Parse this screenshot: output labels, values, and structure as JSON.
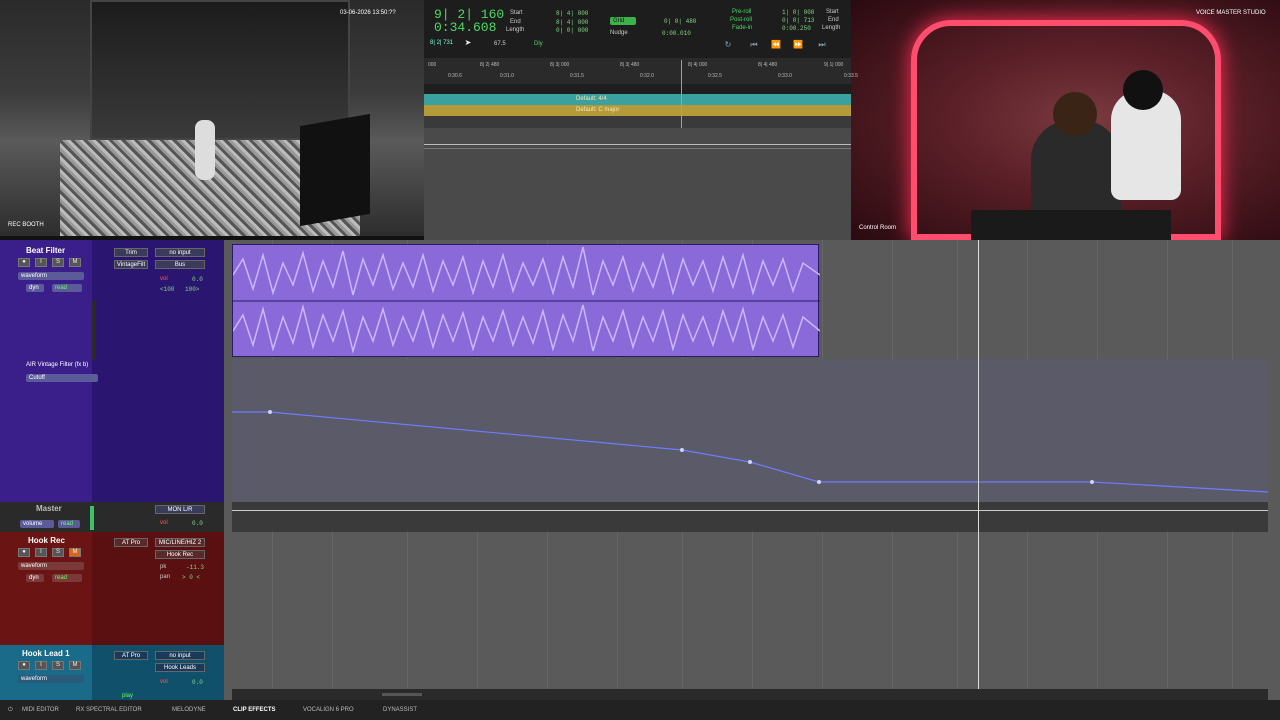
{
  "cameras": {
    "left": {
      "label": "REC BOOTH",
      "timestamp": "03-06-2026 13:50:??"
    },
    "right": {
      "label": "Control Room",
      "watermark": "VOICE MASTER STUDIO"
    }
  },
  "transport": {
    "main_counter_bars": "9| 2| 160",
    "main_counter_time": "0:34.608",
    "sub_counter": "8| 2| 731",
    "start_label": "Start",
    "end_label": "End",
    "length_label": "Length",
    "start_val": "8| 4| 000",
    "end_val": "8| 4| 000",
    "length_val": "0| 0| 000",
    "tempo_val": "67.5",
    "dly_label": "Dly",
    "grid_label": "Grid",
    "grid_val": "0| 0| 480",
    "nudge_label": "Nudge",
    "nudge_val": "0:00.010",
    "preroll_label": "Pre-roll",
    "postroll_label": "Post-roll",
    "fadein_label": "Fade-in",
    "preroll_val": "1| 0| 000",
    "postroll_val": "0| 0| 713",
    "fadein_val": "0:00.250",
    "start2_label": "Start",
    "end2_label": "End",
    "length2_label": "Length"
  },
  "ruler": {
    "bars": [
      "000",
      "8| 2| 480",
      "8| 3| 000",
      "8| 3| 480",
      "8| 4| 000",
      "8| 4| 480",
      "9| 1| 000"
    ],
    "times": [
      "0:30.6",
      "0:31.0",
      "0:31.5",
      "0:32.0",
      "0:32.5",
      "0:33.0",
      "0:33.5"
    ]
  },
  "meter_label": "Default: 4/4",
  "key_label": "Default: C major",
  "tracks": {
    "beat_filter": {
      "name": "Beat Filter",
      "rec": "●",
      "input": "I",
      "solo": "S",
      "mute": "M",
      "view": "waveform",
      "automation_param": "dyn",
      "automation_mode": "read",
      "insert1": "Trim",
      "insert2": "VintageFilt",
      "io_in": "no input",
      "io_out": "Bus",
      "vol_label": "vol",
      "vol_val": "0.0",
      "pan_left": "<100",
      "pan_right": "100>",
      "plugin_lane_label": "AIR Vintage Filter (fx b)",
      "plugin_lane_param": "Cutoff"
    },
    "master": {
      "name": "Master",
      "view": "volume",
      "automation_mode": "read",
      "io_out": "MON L/R",
      "vol_label": "vol",
      "vol_val": "0.0"
    },
    "hook_rec": {
      "name": "Hook Rec",
      "rec": "●",
      "input": "I",
      "solo": "S",
      "mute": "M",
      "view": "waveform",
      "automation_param": "dyn",
      "automation_mode": "read",
      "insert1": "AT Pro",
      "io_in": "MIC/LINE/HIZ 2",
      "io_out": "Hook Rec",
      "pk_label": "pk",
      "pk_val": "-11.3",
      "pan_label": "pan",
      "pan_val": "> 0 <"
    },
    "hook_lead": {
      "name": "Hook Lead 1",
      "rec": "●",
      "input": "I",
      "solo": "S",
      "mute": "M",
      "view": "waveform",
      "insert1": "AT Pro",
      "io_in": "no input",
      "io_out": "Hook Leads",
      "vol_label": "vol",
      "vol_val": "0.0",
      "play_label": "play"
    }
  },
  "bottom_tabs": [
    "MIDI EDITOR",
    "RX SPECTRAL EDITOR",
    "MELODYNE",
    "CLIP EFFECTS",
    "VOCALIGN 6 PRO",
    "DYNASSIST"
  ],
  "colors": {
    "beat_filter": "#3a1f8a",
    "master": "#3a3a3a",
    "hook_rec": "#6a1414",
    "hook_lead": "#1a6a8a",
    "clip": "#8a6ad8",
    "waveform": "#b9a3ff",
    "automation": "#6f7cff"
  }
}
